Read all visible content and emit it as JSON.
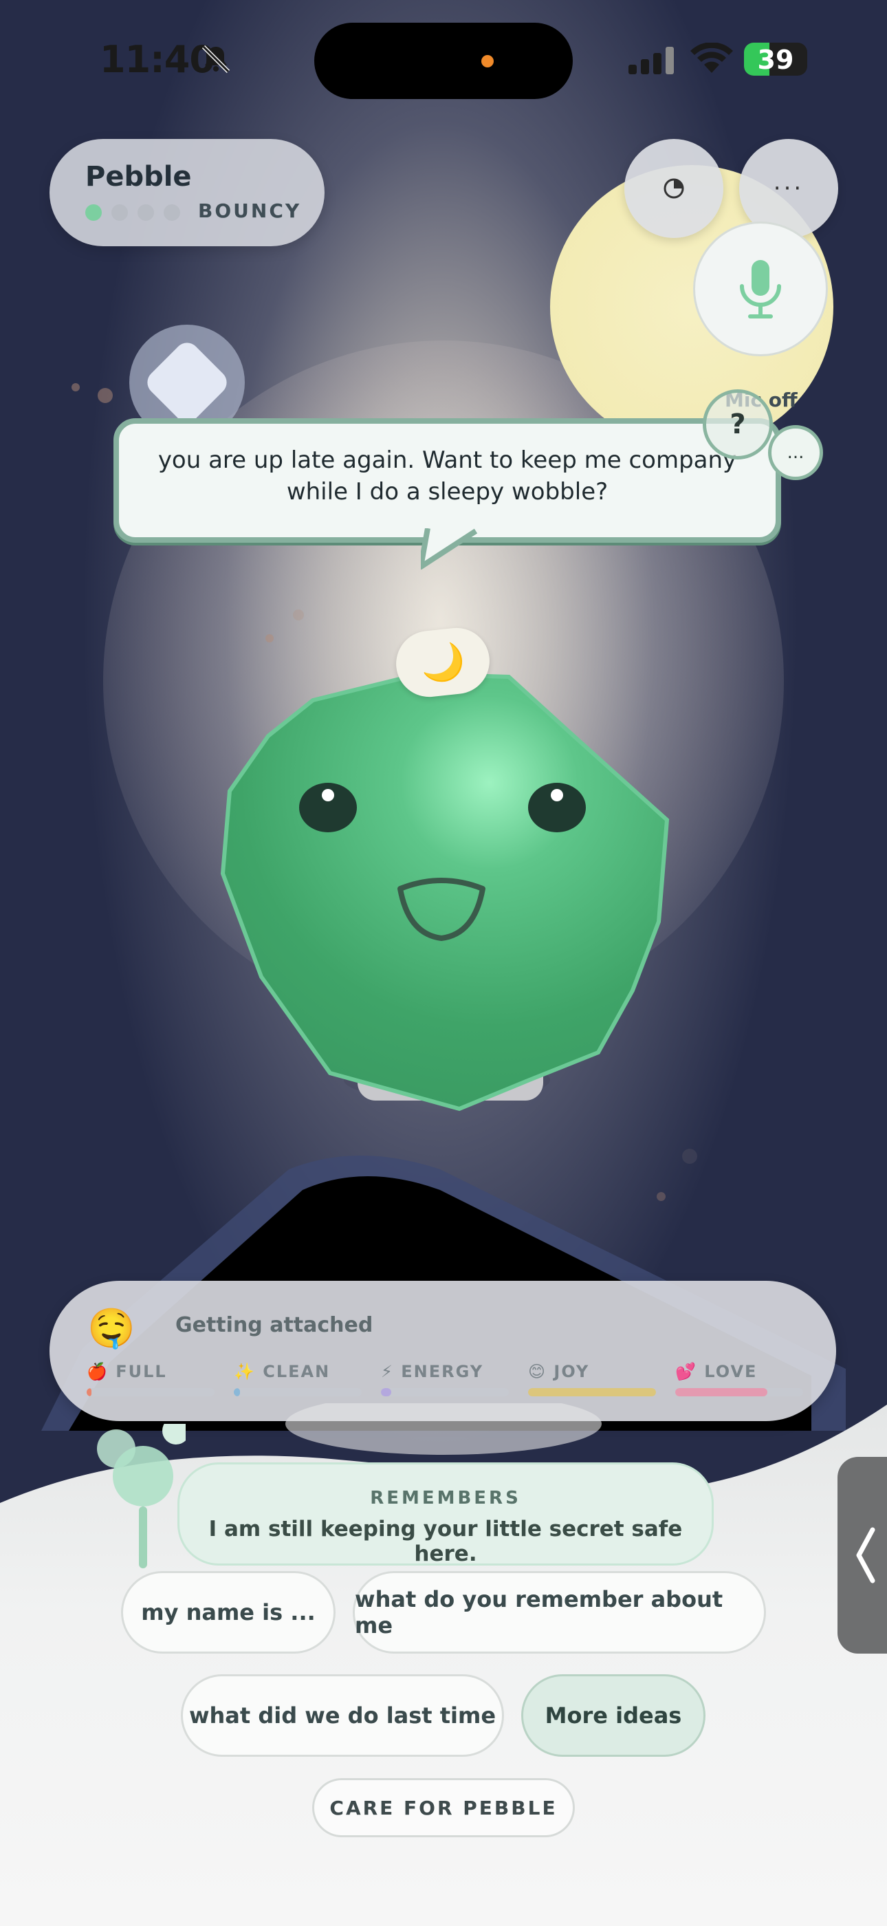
{
  "status_bar": {
    "time": "11:40",
    "battery": "39"
  },
  "pet": {
    "name": "Pebble",
    "stage": "BOUNCY",
    "stage_dots": [
      true,
      false,
      false,
      false
    ]
  },
  "controls": {
    "mic_label": "Mic off",
    "help_label": "?",
    "more_label": "..."
  },
  "speech": {
    "text": "you are up late again. Want to keep me company while I do a sleepy wobble?",
    "mood_badge": "🌙"
  },
  "status_panel": {
    "mood_emoji": "🤤",
    "mood_text": "Getting attached",
    "stats": [
      {
        "icon": "🍎",
        "label": "FULL",
        "value": 0.04,
        "color": "#e8866e"
      },
      {
        "icon": "✨",
        "label": "CLEAN",
        "value": 0.05,
        "color": "#8ab8d8"
      },
      {
        "icon": "⚡",
        "label": "ENERGY",
        "value": 0.08,
        "color": "#b4a8de"
      },
      {
        "icon": "😊",
        "label": "JOY",
        "value": 1.0,
        "color": "#dcc67c"
      },
      {
        "icon": "💕",
        "label": "LOVE",
        "value": 0.72,
        "color": "#e49ab0"
      }
    ]
  },
  "memory": {
    "title": "REMEMBERS",
    "text": "I am still keeping your little secret safe here."
  },
  "suggestions": {
    "chip1": "my name is ...",
    "chip2": "what do you remember about me",
    "chip3": "what did we do last time",
    "chip4": "More ideas"
  },
  "care_button": "CARE FOR PEBBLE"
}
